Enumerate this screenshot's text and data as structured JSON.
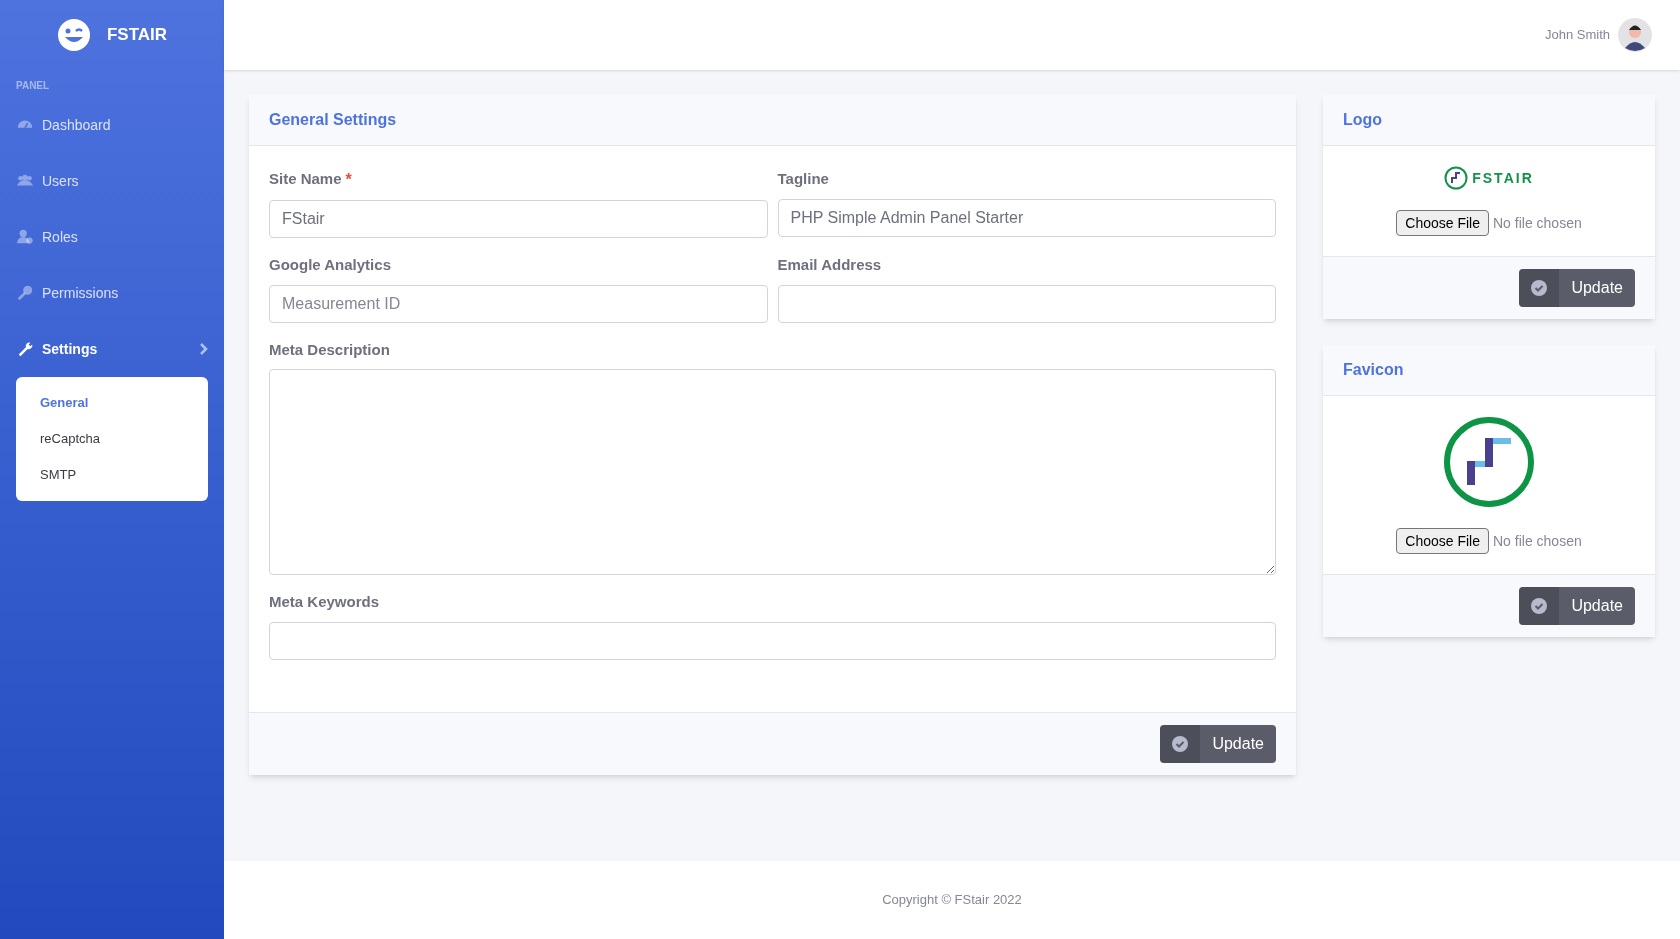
{
  "brand": {
    "name": "FSTAIR"
  },
  "sidebar": {
    "section_label": "PANEL",
    "items": [
      {
        "label": "Dashboard",
        "selected": false
      },
      {
        "label": "Users",
        "selected": false
      },
      {
        "label": "Roles",
        "selected": false
      },
      {
        "label": "Permissions",
        "selected": false
      },
      {
        "label": "Settings",
        "selected": true,
        "expanded": true,
        "children": [
          {
            "label": "General",
            "selected": true
          },
          {
            "label": "reCaptcha",
            "selected": false
          },
          {
            "label": "SMTP",
            "selected": false
          }
        ]
      }
    ]
  },
  "topbar": {
    "user_name": "John Smith"
  },
  "general_settings": {
    "title": "General Settings",
    "fields": [
      {
        "kind": "input",
        "label": "Site Name",
        "required_mark": "*",
        "value": "FStair"
      },
      {
        "kind": "input",
        "label": "Tagline",
        "value": "PHP Simple Admin Panel Starter"
      },
      {
        "kind": "input",
        "label": "Google Analytics",
        "placeholder": "Measurement ID"
      },
      {
        "kind": "input",
        "label": "Email Address"
      },
      {
        "kind": "textarea",
        "label": "Meta Description"
      },
      {
        "kind": "input",
        "label": "Meta Keywords"
      }
    ],
    "button": "Update"
  },
  "logo_card": {
    "title": "Logo",
    "wordmark": "FSTAIR",
    "choose_button": "Choose File",
    "file_status": "No file chosen",
    "button": "Update"
  },
  "favicon_card": {
    "title": "Favicon",
    "choose_button": "Choose File",
    "file_status": "No file chosen",
    "button": "Update"
  },
  "footer": {
    "text": "Copyright © FStair 2022"
  }
}
